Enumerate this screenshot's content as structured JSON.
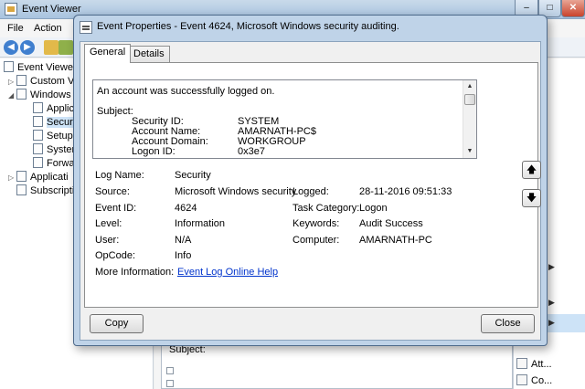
{
  "background": {
    "title": "Event Viewer",
    "menu": [
      "File",
      "Action"
    ],
    "tree": [
      {
        "label": "Event Viewer",
        "level": 0
      },
      {
        "label": "Custom V",
        "level": 1
      },
      {
        "label": "Windows",
        "level": 1
      },
      {
        "label": "Applic",
        "level": 2
      },
      {
        "label": "Securi",
        "level": 2
      },
      {
        "label": "Setup",
        "level": 2
      },
      {
        "label": "Syster",
        "level": 2
      },
      {
        "label": "Forwa",
        "level": 2
      },
      {
        "label": "Applicati",
        "level": 1
      },
      {
        "label": "Subscripti",
        "level": 1
      }
    ],
    "detail_subject": "Subject:",
    "actions": [
      "Att...",
      "Co..."
    ]
  },
  "dialog": {
    "title": "Event Properties - Event 4624, Microsoft Windows security auditing.",
    "tabs": [
      "General",
      "Details"
    ],
    "active_tab": "General",
    "description": {
      "summary": "An account was successfully logged on.",
      "subject_label": "Subject:",
      "fields": [
        {
          "key": "Security ID:",
          "value": "SYSTEM"
        },
        {
          "key": "Account Name:",
          "value": "AMARNATH-PC$"
        },
        {
          "key": "Account Domain:",
          "value": "WORKGROUP"
        },
        {
          "key": "Logon ID:",
          "value": "0x3e7"
        }
      ]
    },
    "labels": {
      "log_name": "Log Name:",
      "source": "Source:",
      "event_id": "Event ID:",
      "level": "Level:",
      "user": "User:",
      "opcode": "OpCode:",
      "more_info": "More Information:",
      "logged": "Logged:",
      "task_category": "Task Category:",
      "keywords": "Keywords:",
      "computer": "Computer:"
    },
    "values": {
      "log_name": "Security",
      "source": "Microsoft Windows security",
      "event_id": "4624",
      "level": "Information",
      "user": "N/A",
      "opcode": "Info",
      "more_info_link": "Event Log Online Help",
      "logged": "28-11-2016 09:51:33",
      "task_category": "Logon",
      "keywords": "Audit Success",
      "computer": "AMARNATH-PC"
    },
    "buttons": {
      "copy": "Copy",
      "close": "Close"
    }
  }
}
